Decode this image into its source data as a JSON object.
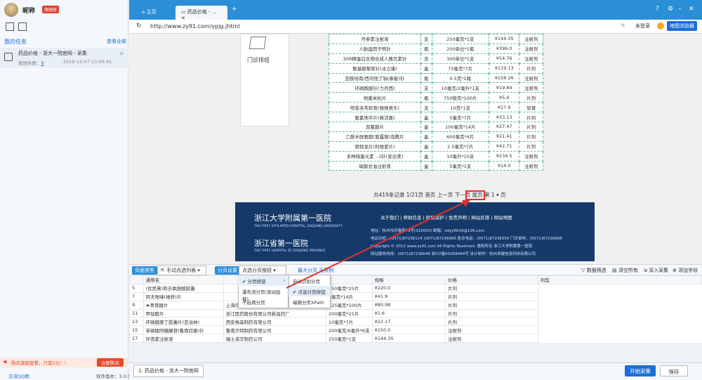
{
  "user": {
    "name": "昵称",
    "badge": "旗舰版"
  },
  "sidebar": {
    "title": "我的任务",
    "more": "查看全部",
    "task": {
      "name": "药品价格 - 浙大一院官网 - 采集",
      "count_label": "数据条数：",
      "count": "0",
      "time": "2018-12-07 13:59:45"
    }
  },
  "promo": {
    "text": "购买旗舰套餐，只需2元！!",
    "button": "立即购买"
  },
  "footer": {
    "qq": "交流QQ群",
    "version": "软件版本：3.0.5"
  },
  "tabs": [
    {
      "label": "主页"
    },
    {
      "label": "药品价格 - ..."
    }
  ],
  "address": {
    "url": "http://www.zy91.com/ypjg.jhtml",
    "login": "未登录",
    "map": "地图浏览器"
  },
  "clinic": "门诊排班",
  "price_rows": [
    [
      "丹参素注射液",
      "支",
      "250毫克*1支",
      "¥144.35",
      "注射剂"
    ],
    [
      "人胎盘因子喷针",
      "瓶",
      "200单位*1瓶",
      "¥396.0",
      "注射剂"
    ],
    [
      "30R精蛋白生物合成人胰岛素针",
      "支",
      "300单位*1支",
      "¥54.76",
      "注射剂"
    ],
    [
      "氨基酸葡萄针(冰立康)",
      "盒",
      "75毫克*7片",
      "¥119.13",
      "片剂"
    ],
    [
      "亚胺培南/西司他丁钠(泰能)针",
      "瓶",
      "0.5克*1瓶",
      "¥158.26",
      "注射剂"
    ],
    [
      "环磷酰胺针(力月西)",
      "支",
      "10毫克/2毫升*1支",
      "¥19.84",
      "注射剂"
    ],
    [
      "地塞米松片",
      "瓶",
      "750微克*100片",
      "¥5.4",
      "片剂"
    ],
    [
      "喷昔洛韦软膏(丽珠君乐)",
      "支",
      "10克*1支",
      "¥17.6",
      "软膏"
    ],
    [
      "氨氯地平片(络活喜)",
      "盒",
      "5毫克*7片",
      "¥33.13",
      "片剂"
    ],
    [
      "双氯酸片",
      "盒",
      "100毫克*14片",
      "¥27.47",
      "片剂"
    ],
    [
      "乙酰半胱氨酸(富露施)泡腾片",
      "盒",
      "600毫克*4片",
      "¥21.41",
      "片剂"
    ],
    [
      "替勃龙片(利维爱片)",
      "盒",
      "2.5毫克*7片",
      "¥42.71",
      "片剂"
    ],
    [
      "多种微量元素 - 2针(安达美)",
      "盒",
      "10毫升*10支",
      "¥234.5",
      "注射剂"
    ],
    [
      "硝酸甘油注射液",
      "盒",
      "5毫克*1支",
      "¥14.0",
      "注射剂"
    ]
  ],
  "pager": {
    "text": "共419条记录 1/21页 首页 上一页 下一页 尾页 第 1 ▾ 页"
  },
  "site_footer": {
    "logo1": "浙江大学附属第一医院",
    "logo_en": "THE FIRST AFFILIATED HOSPITAL, ZHEJIANG UNIVERSITY",
    "logo2": "浙江省第一医院",
    "logo2_en": "THE FIRST HOSPITAL OF ZHEJIANG PROVINCE",
    "nav": "关于我们 | 帮助信息 | 隐私保护 | 免责声明 | 网站反馈 | 网站地图",
    "line1": "地址：杭州市庆春路79号(310003) 邮箱：zdyy6616@126.com",
    "line2": "电话总机：(0571)87236114 (0571)87236666 急诊电话：(0571)87236300 门诊审核：(0571)87236666",
    "line3": "Copyright © 2012 www.zy91.com All Rights Reserved. 版权所有 浙江大学附属第一医院",
    "line4": "网站服务热线：(0571)87236648 浙ICP备05058494号 设计制作：杭州卓健信息科技有限公司"
  },
  "toolbar": {
    "page_type": "页面类型",
    "page_type_val": "手动点选列表",
    "page_set": "分页设置",
    "page_set_val": "点选分页按钮",
    "max_pages": "最大分页",
    "max_pages_val": "无限制",
    "filter": "数据筛选",
    "clear": "清空所有",
    "deep": "深入采集",
    "add_field": "添加字段"
  },
  "menu1": [
    "分页按钮",
    "瀑布流分页(滚动加载)",
    "不启用分页"
  ],
  "menu2": [
    "自动识别分页",
    "点选分页按钮",
    "编辑分页XPath"
  ],
  "data_table": {
    "headers": [
      "通用名",
      "",
      "",
      "规格",
      "价格",
      "剂型"
    ],
    "rows": [
      [
        "5",
        "(优思弗)熊去氧胆酸胶囊",
        "",
        "250毫克*25片",
        "¥220.0",
        "片剂"
      ],
      [
        "7",
        "阿夫唑嗪(维舒)片",
        "",
        "5毫克*14片",
        "¥41.9",
        "片剂"
      ],
      [
        "9",
        "★青蒿酸片",
        "上海信谊药厂",
        "125毫克*100片",
        "¥80.98",
        "片剂"
      ],
      [
        "11",
        "甲钴胺片",
        "浙江医药股份有限公司新昌药厂",
        "200毫克*21片",
        "¥1.6",
        "片剂"
      ],
      [
        "13",
        "环磷酰胺丁胶囊片(亚治林)",
        "西安杨森制药有限公司",
        "10毫克*7片",
        "¥22.17",
        "片剂"
      ],
      [
        "15",
        "单磷酸阿糖腺苷(鲁南欣康)针",
        "鲁南贝特制药有限公司",
        "200毫克/6毫升*6支",
        "¥150.0",
        "注射剂"
      ],
      [
        "17",
        "环孢素注射液",
        "瑞士诺华制药公司",
        "250毫克*1支",
        "¥144.35",
        "注射剂"
      ]
    ]
  },
  "bottom": {
    "tab": "1. 药品价格 - 浙大一院官网",
    "start": "开始采集",
    "save": "保存"
  }
}
